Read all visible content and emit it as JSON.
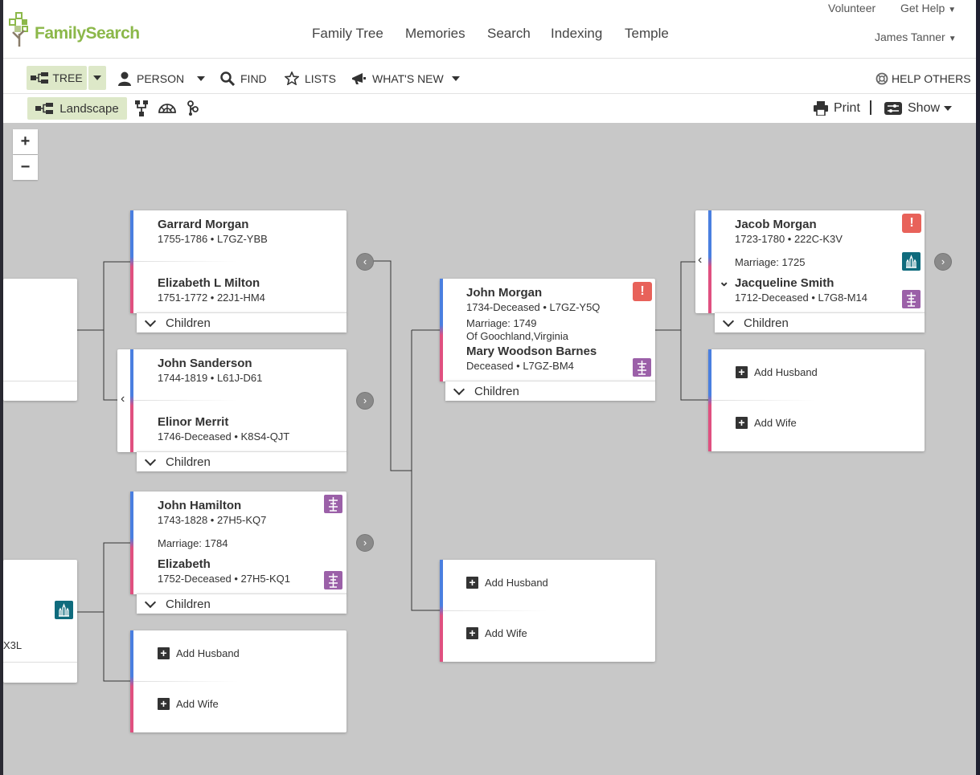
{
  "header": {
    "logo_text": "FamilySearch",
    "nav": [
      "Family Tree",
      "Memories",
      "Search",
      "Indexing",
      "Temple"
    ],
    "volunteer": "Volunteer",
    "get_help": "Get Help",
    "user": "James Tanner"
  },
  "toolbar": {
    "tree": "TREE",
    "person": "PERSON",
    "find": "FIND",
    "lists": "LISTS",
    "whats_new": "WHAT'S NEW",
    "help_others": "HELP OTHERS"
  },
  "viewbar": {
    "landscape": "Landscape",
    "print": "Print",
    "show": "Show"
  },
  "zoom": {
    "in": "+",
    "out": "−"
  },
  "children_label": "Children",
  "add_husband": "Add Husband",
  "add_wife": "Add Wife",
  "couples": {
    "garrard": {
      "husband": {
        "name": "Garrard Morgan",
        "meta": "1755-1786 • L7GZ-YBB"
      },
      "wife": {
        "name": "Elizabeth L Milton",
        "meta": "1751-1772 • 22J1-HM4"
      }
    },
    "sanderson": {
      "husband": {
        "name": "John Sanderson",
        "meta": "1744-1819 • L61J-D61"
      },
      "wife": {
        "name": "Elinor Merrit",
        "meta": "1746-Deceased • K8S4-QJT"
      }
    },
    "hamilton": {
      "husband": {
        "name": "John Hamilton",
        "meta": "1743-1828 • 27H5-KQ7"
      },
      "marriage": "Marriage: 1784",
      "wife": {
        "name": "Elizabeth",
        "meta": "1752-Deceased • 27H5-KQ1"
      }
    },
    "john_morgan": {
      "husband": {
        "name": "John Morgan",
        "meta": "1734-Deceased • L7GZ-Y5Q"
      },
      "marriage": "Marriage: 1749",
      "marriage_place": "Of Goochland,Virginia",
      "wife": {
        "name": "Mary Woodson Barnes",
        "meta": "Deceased • L7GZ-BM4"
      }
    },
    "jacob": {
      "husband": {
        "name": "Jacob Morgan",
        "meta": "1723-1780 • 222C-K3V"
      },
      "marriage": "Marriage: 1725",
      "wife": {
        "name": "Jacqueline Smith",
        "meta": "1712-Deceased • L7G8-M14"
      }
    }
  },
  "partial_card_text": "X3L",
  "colors": {
    "brand_green": "#8cb84a",
    "selected_bg": "#dde8c8",
    "male_accent": "#4a7fe0",
    "female_accent": "#e05080",
    "alert": "#e8625a",
    "temple": "#0f6b7d",
    "record": "#9b60a8"
  },
  "icons": [
    "tree-icon",
    "person-icon",
    "magnifier-icon",
    "star-icon",
    "megaphone-icon",
    "lifebuoy-icon",
    "landscape-icon",
    "portrait-icon",
    "fan-icon",
    "descendancy-icon",
    "printer-icon",
    "settings-icon",
    "alert-icon",
    "temple-icon",
    "record-hint-icon",
    "plus-icon",
    "chevron-down-icon",
    "chevron-left-icon",
    "chevron-right-icon"
  ]
}
